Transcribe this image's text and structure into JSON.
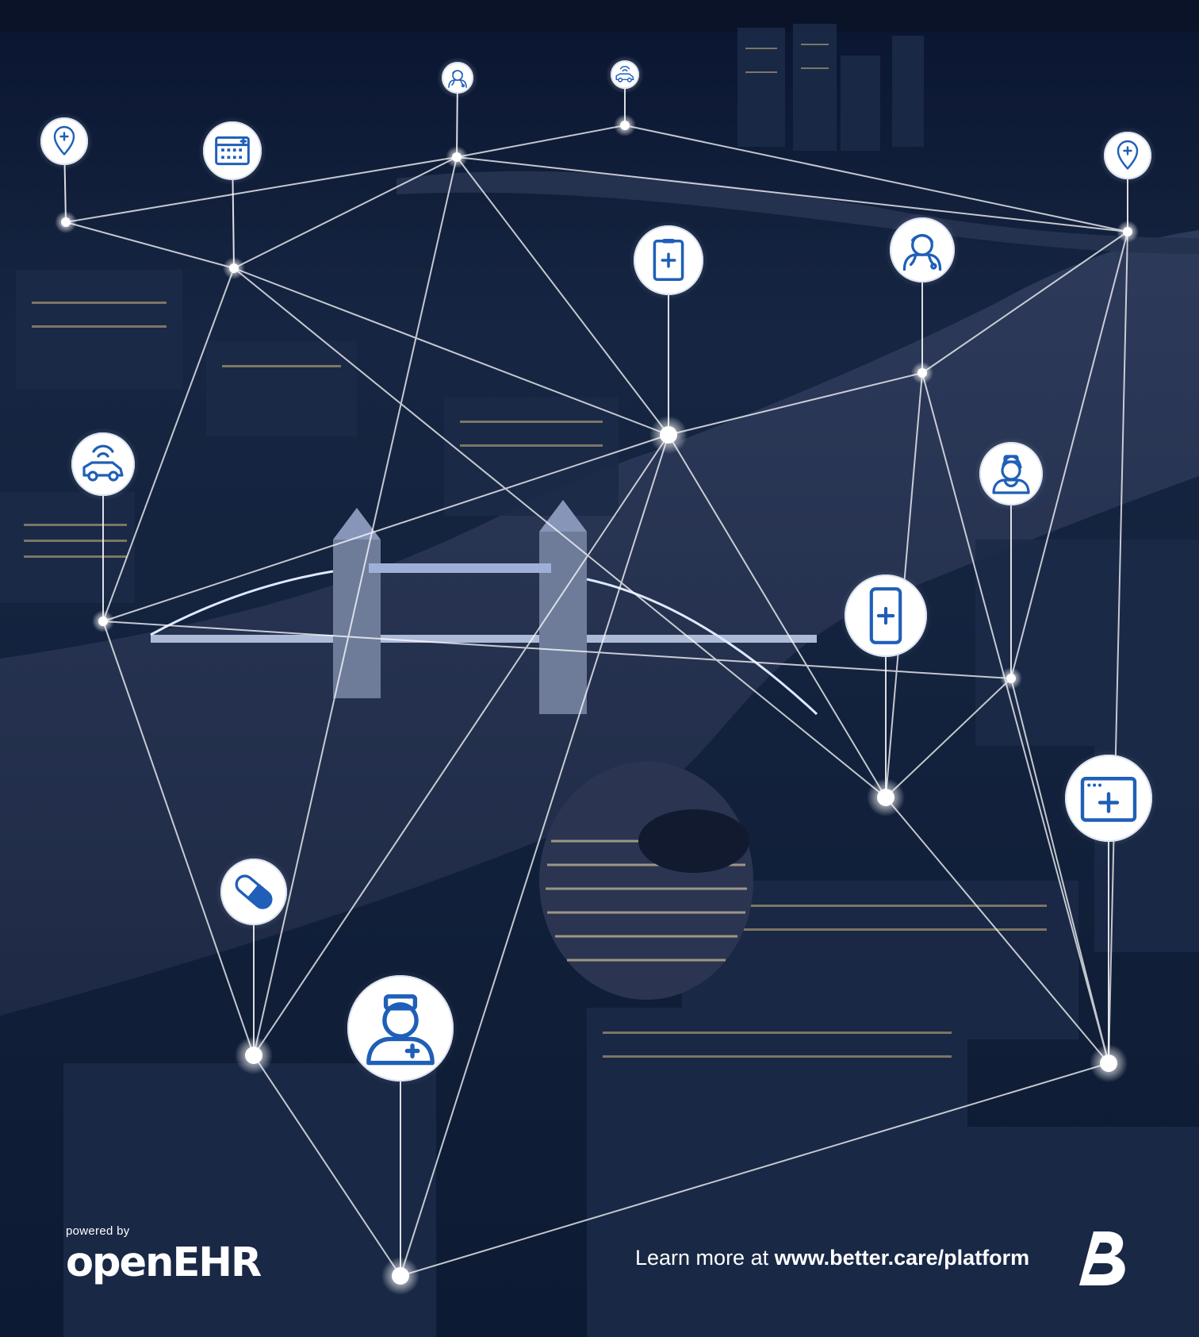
{
  "footer": {
    "powered_by": "powered by",
    "brand": "openEHR",
    "learn_prefix": "Learn more at ",
    "learn_url": "www.better.care/platform",
    "logo_letter": "B"
  },
  "colors": {
    "icon_blue": "#1f5fb8",
    "node_white": "#ffffff",
    "sky": "#0a1530",
    "river": "#2a3656"
  },
  "nodes": [
    {
      "icon": "location-pin-plus-icon"
    },
    {
      "icon": "hospital-building-icon"
    },
    {
      "icon": "doctor-small-icon"
    },
    {
      "icon": "connected-device-icon"
    },
    {
      "icon": "location-pin-plus-icon"
    },
    {
      "icon": "medical-tablet-icon"
    },
    {
      "icon": "doctor-icon"
    },
    {
      "icon": "connected-car-icon"
    },
    {
      "icon": "nurse-female-icon"
    },
    {
      "icon": "mobile-health-icon"
    },
    {
      "icon": "medical-window-icon"
    },
    {
      "icon": "pill-icon"
    },
    {
      "icon": "nurse-male-icon"
    }
  ]
}
